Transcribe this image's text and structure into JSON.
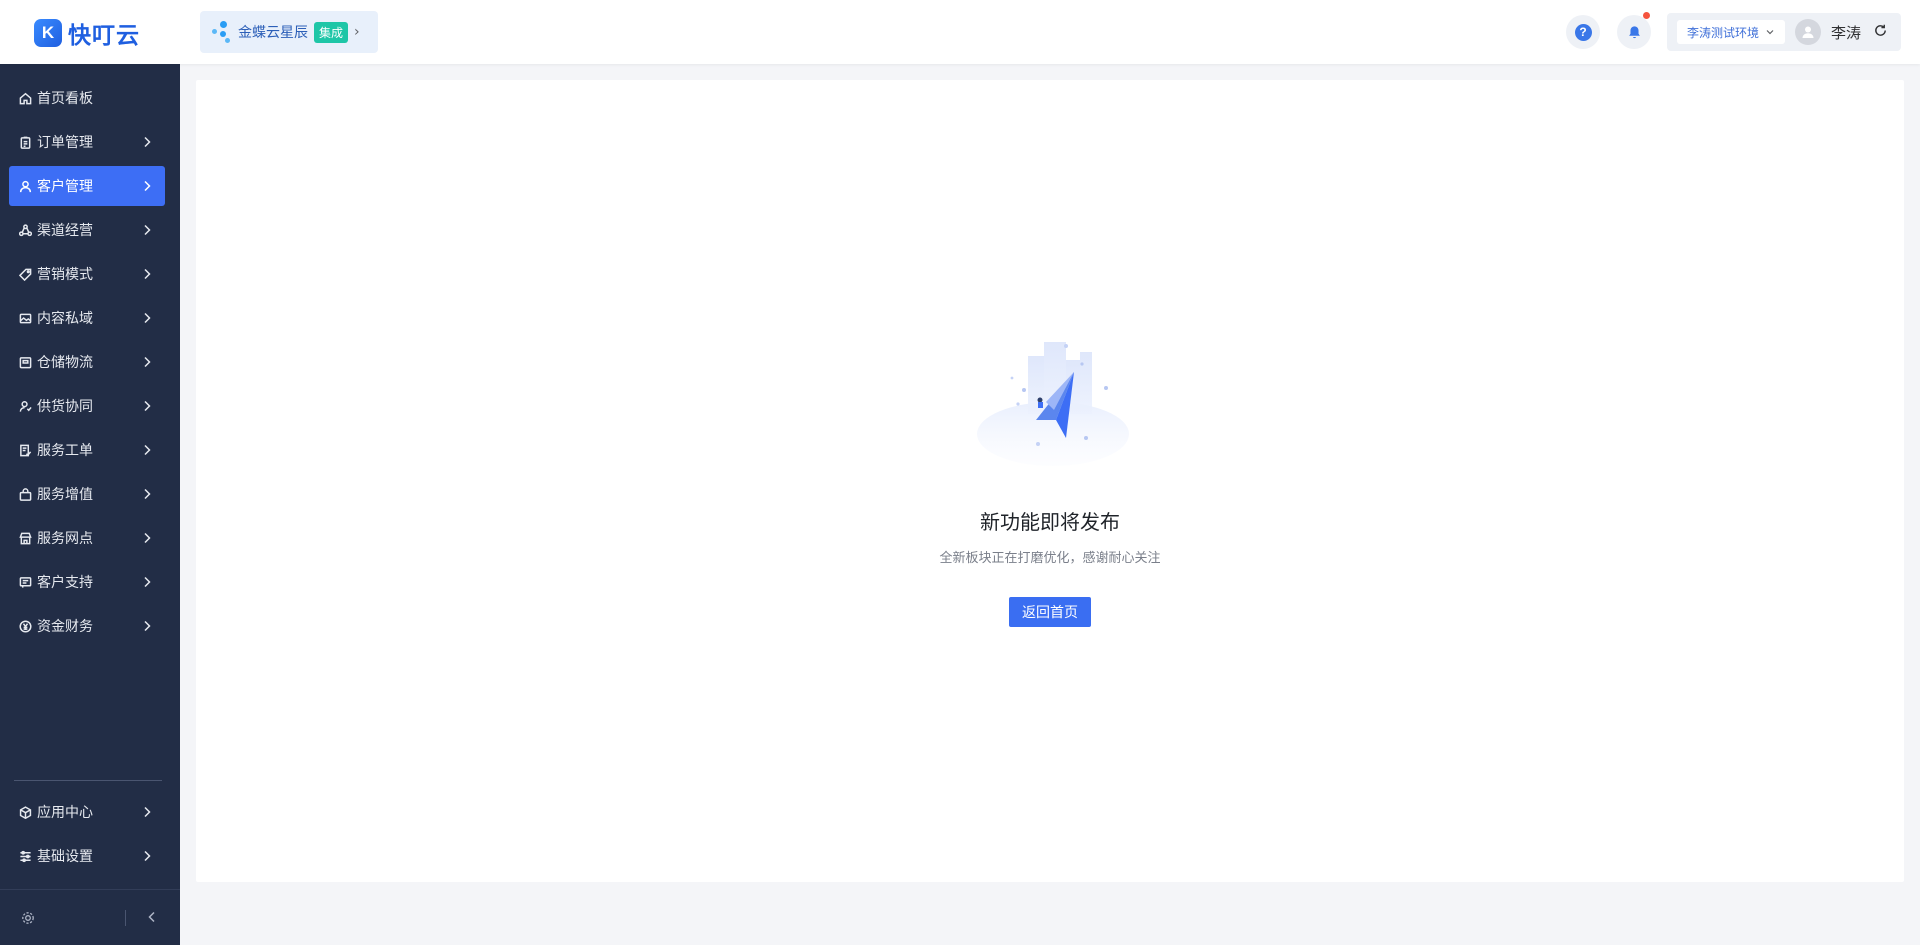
{
  "app": {
    "logo_text": "快叮云",
    "logo_mark": "K"
  },
  "integration": {
    "name": "金蝶云星辰",
    "badge": "集成"
  },
  "header": {
    "environment": "李涛测试环境",
    "user_name": "李涛"
  },
  "sidebar": {
    "items": [
      {
        "label": "首页看板",
        "icon": "home-icon",
        "has_arrow": false
      },
      {
        "label": "订单管理",
        "icon": "clipboard-icon",
        "has_arrow": true
      },
      {
        "label": "客户管理",
        "icon": "user-icon",
        "has_arrow": true,
        "active": true
      },
      {
        "label": "渠道经营",
        "icon": "channel-icon",
        "has_arrow": true
      },
      {
        "label": "营销模式",
        "icon": "tag-icon",
        "has_arrow": true
      },
      {
        "label": "内容私域",
        "icon": "image-icon",
        "has_arrow": true
      },
      {
        "label": "仓储物流",
        "icon": "warehouse-icon",
        "has_arrow": true
      },
      {
        "label": "供货协同",
        "icon": "supplier-icon",
        "has_arrow": true
      },
      {
        "label": "服务工单",
        "icon": "workorder-icon",
        "has_arrow": true
      },
      {
        "label": "服务增值",
        "icon": "bag-icon",
        "has_arrow": true
      },
      {
        "label": "服务网点",
        "icon": "store-icon",
        "has_arrow": true
      },
      {
        "label": "客户支持",
        "icon": "support-icon",
        "has_arrow": true
      },
      {
        "label": "资金财务",
        "icon": "yen-icon",
        "has_arrow": true
      }
    ],
    "bottom_items": [
      {
        "label": "应用中心",
        "icon": "cube-icon",
        "has_arrow": true
      },
      {
        "label": "基础设置",
        "icon": "settings-icon",
        "has_arrow": true
      }
    ]
  },
  "main": {
    "title": "新功能即将发布",
    "description": "全新板块正在打磨优化，感谢耐心关注",
    "button_label": "返回首页"
  },
  "colors": {
    "sidebar_bg": "#222d46",
    "accent": "#3d6ef5",
    "integration_badge": "#1ec6a7",
    "notification_dot": "#f5533d"
  }
}
